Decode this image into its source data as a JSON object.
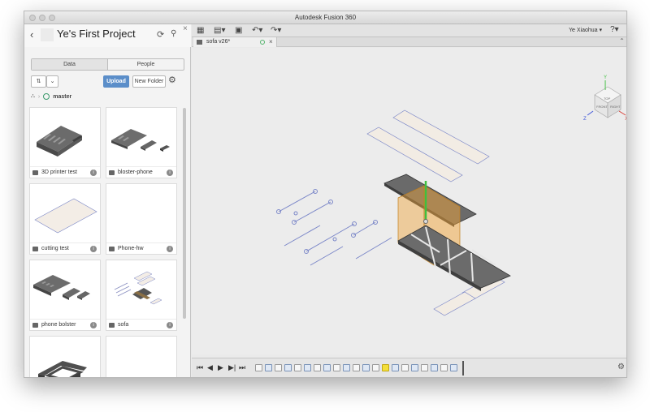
{
  "window": {
    "title": "Autodesk Fusion 360"
  },
  "panel": {
    "project_title": "Ye's First Project",
    "tabs": [
      {
        "label": "Data"
      },
      {
        "label": "People"
      }
    ],
    "upload_label": "Upload",
    "new_folder_label": "New Folder",
    "breadcrumb_branch": "master",
    "items": [
      {
        "name": "3D printer test"
      },
      {
        "name": "bloster-phone"
      },
      {
        "name": "cutting test"
      },
      {
        "name": "Phone-hw"
      },
      {
        "name": "phone bolster"
      },
      {
        "name": "sofa"
      },
      {
        "name": ""
      },
      {
        "name": ""
      }
    ]
  },
  "toolbar": {
    "user": "Ye Xiaohua ▾"
  },
  "document_tab": {
    "label": "sofa v26*"
  },
  "viewcube": {
    "face_top": "TOP",
    "face_front": "FRONT",
    "face_right": "RIGHT",
    "axis_x": "X",
    "axis_y": "Y",
    "axis_z": "Z"
  },
  "colors": {
    "accent": "#5b8ec9",
    "selection": "#f0a33a",
    "axis_y": "#3fbf3f"
  }
}
